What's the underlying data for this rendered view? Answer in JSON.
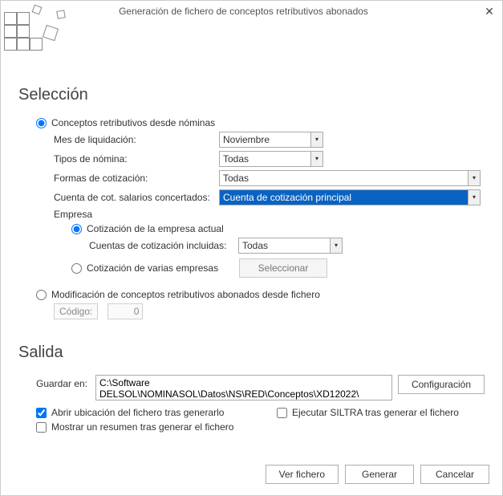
{
  "window": {
    "title": "Generación de fichero de conceptos retributivos abonados"
  },
  "seleccion": {
    "heading": "Selección",
    "opt_nominas": "Conceptos retributivos desde nóminas",
    "mes_label": "Mes de liquidación:",
    "mes_value": "Noviembre",
    "tipo_label": "Tipos de nómina:",
    "tipo_value": "Todas",
    "formas_label": "Formas de cotización:",
    "formas_value": "Todas",
    "cuenta_label": "Cuenta de cot. salarios concertados:",
    "cuenta_value": "Cuenta de cotización principal",
    "empresa_label": "Empresa",
    "cot_actual": "Cotización de la empresa actual",
    "cuentas_incl_label": "Cuentas de cotización incluidas:",
    "cuentas_incl_value": "Todas",
    "cot_varias": "Cotización de varias empresas",
    "seleccionar_btn": "Seleccionar",
    "opt_fichero": "Modificación de conceptos retributivos abonados desde fichero",
    "codigo_label": "Código:",
    "codigo_value": "0"
  },
  "salida": {
    "heading": "Salida",
    "guardar_label": "Guardar en:",
    "path": "C:\\Software DELSOL\\NOMINASOL\\Datos\\NS\\RED\\Conceptos\\XD12022\\",
    "config_btn": "Configuración",
    "chk_abrir": "Abrir ubicación del fichero tras generarlo",
    "chk_siltra": "Ejecutar SILTRA tras generar el fichero",
    "chk_resumen": "Mostrar un resumen tras generar el fichero"
  },
  "footer": {
    "ver": "Ver fichero",
    "generar": "Generar",
    "cancelar": "Cancelar"
  }
}
